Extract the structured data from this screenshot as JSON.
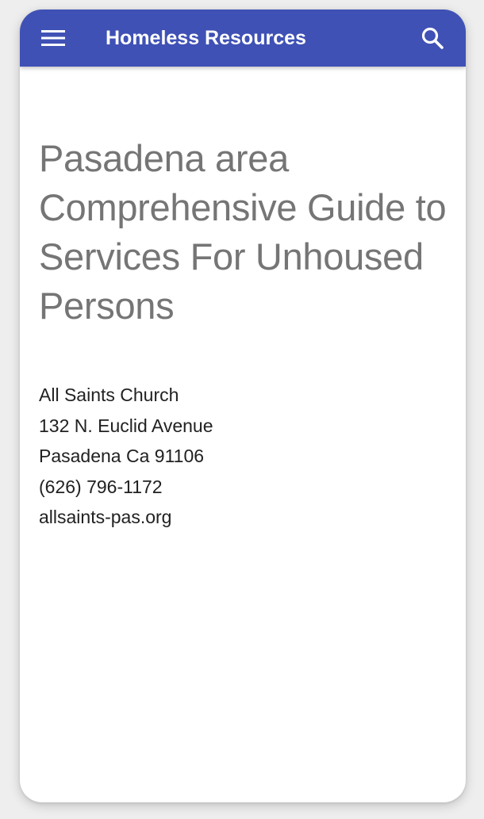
{
  "app_bar": {
    "title": "Homeless Resources",
    "menu_icon": "hamburger-menu-icon",
    "search_icon": "search-icon",
    "color": "#3f51b5"
  },
  "main": {
    "heading": "Pasadena area Comprehensive Guide to Services For Unhoused Persons",
    "contact": {
      "name": "All Saints Church",
      "street": "132 N. Euclid Avenue",
      "city_state_zip": "Pasadena Ca 91106",
      "phone": "(626) 796-1172",
      "website": "allsaints-pas.org"
    }
  }
}
